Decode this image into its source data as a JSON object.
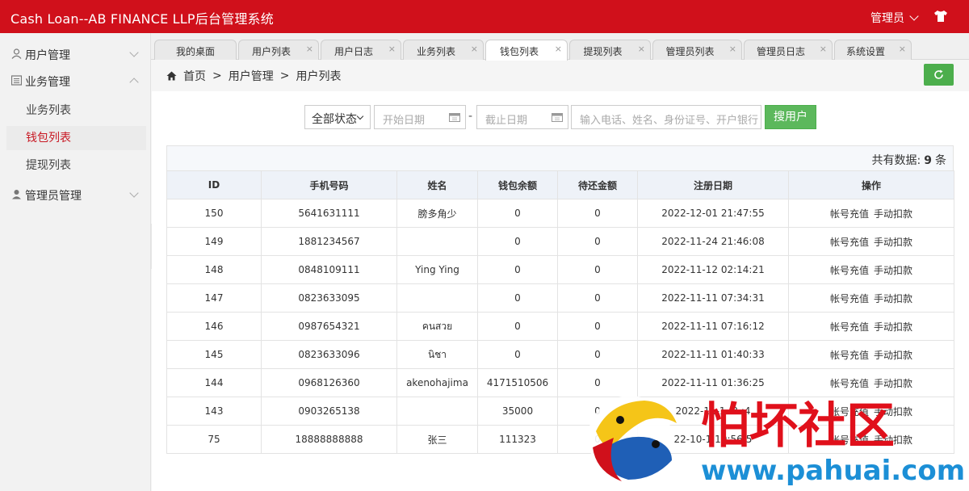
{
  "app": {
    "title": "Cash Loan--AB FINANCE LLP后台管理系统",
    "user": "管理员",
    "colors": {
      "brand": "#d0101b",
      "green": "#5cb85c"
    }
  },
  "sidebar": {
    "groups": [
      {
        "label": "用户管理",
        "icon": "user-icon"
      },
      {
        "label": "业务管理",
        "icon": "list-icon"
      },
      {
        "label": "管理员管理",
        "icon": "admin-icon"
      }
    ],
    "subitems": [
      "业务列表",
      "钱包列表",
      "提现列表"
    ],
    "active": "钱包列表"
  },
  "tabs": [
    {
      "label": "我的桌面"
    },
    {
      "label": "用户列表"
    },
    {
      "label": "用户日志"
    },
    {
      "label": "业务列表"
    },
    {
      "label": "钱包列表"
    },
    {
      "label": "提现列表"
    },
    {
      "label": "管理员列表"
    },
    {
      "label": "管理员日志"
    },
    {
      "label": "系统设置"
    }
  ],
  "close_glyph": "×",
  "breadcrumb": {
    "home": "首页",
    "sep": ">",
    "level1": "用户管理",
    "level2": "用户列表"
  },
  "search": {
    "status": "全部状态",
    "start_placeholder": "开始日期",
    "dash": "-",
    "end_placeholder": "截止日期",
    "keyword_placeholder": "输入电话、姓名、身份证号、开户银行",
    "button": "搜用户"
  },
  "summary": {
    "label": "共有数据:",
    "count": "9",
    "unit": "条"
  },
  "table": {
    "columns": [
      "ID",
      "手机号码",
      "姓名",
      "钱包余额",
      "待还金额",
      "注册日期",
      "操作"
    ],
    "actions": [
      "帐号充值",
      "手动扣款"
    ],
    "rows": [
      {
        "id": "150",
        "phone": "5641631111",
        "name": "膀多角少",
        "balance": "0",
        "due": "0",
        "date": "2022-12-01 21:47:55"
      },
      {
        "id": "149",
        "phone": "1881234567",
        "name": "",
        "balance": "0",
        "due": "0",
        "date": "2022-11-24 21:46:08"
      },
      {
        "id": "148",
        "phone": "0848109111",
        "name": "Ying Ying",
        "balance": "0",
        "due": "0",
        "date": "2022-11-12 02:14:21"
      },
      {
        "id": "147",
        "phone": "0823633095",
        "name": "",
        "balance": "0",
        "due": "0",
        "date": "2022-11-11 07:34:31"
      },
      {
        "id": "146",
        "phone": "0987654321",
        "name": "คนสวย",
        "balance": "0",
        "due": "0",
        "date": "2022-11-11 07:16:12"
      },
      {
        "id": "145",
        "phone": "0823633096",
        "name": "นิชา",
        "balance": "0",
        "due": "0",
        "date": "2022-11-11 01:40:33"
      },
      {
        "id": "144",
        "phone": "0968126360",
        "name": "akenohajima",
        "balance": "4171510506",
        "due": "0",
        "date": "2022-11-11 01:36:25"
      },
      {
        "id": "143",
        "phone": "0903265138",
        "name": "",
        "balance": "35000",
        "due": "0",
        "date": "2022-11-1 :3 :4"
      },
      {
        "id": "75",
        "phone": "18888888888",
        "name": "张三",
        "balance": "111323",
        "due": "0",
        "date": "22-10-1 10:56:5"
      }
    ]
  },
  "watermark": {
    "text": "怕坏社区",
    "url": "www.pahuai.com"
  }
}
